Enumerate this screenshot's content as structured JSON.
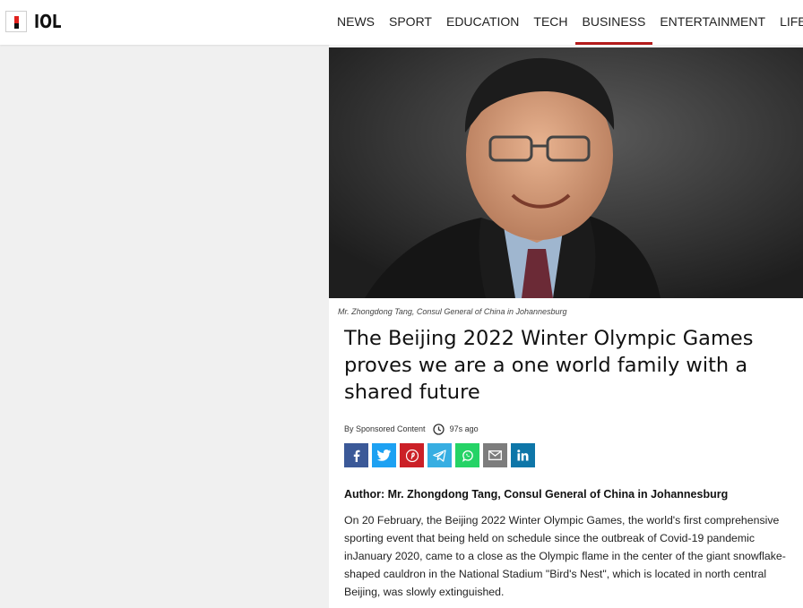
{
  "brand": {
    "name": "IOL"
  },
  "nav": [
    {
      "label": "NEWS",
      "active": false
    },
    {
      "label": "SPORT",
      "active": false
    },
    {
      "label": "EDUCATION",
      "active": false
    },
    {
      "label": "TECH",
      "active": false
    },
    {
      "label": "BUSINESS",
      "active": true
    },
    {
      "label": "ENTERTAINMENT",
      "active": false
    },
    {
      "label": "LIFESTYLE",
      "active": false
    }
  ],
  "article": {
    "caption": "Mr. Zhongdong Tang, Consul General of China in Johannesburg",
    "headline": "The Beijing 2022 Winter Olympic Games proves we are a one world family with a shared future",
    "byline": "By Sponsored Content",
    "time": "97s ago",
    "share": [
      {
        "icon": "facebook-icon",
        "color": "#3b5998"
      },
      {
        "icon": "twitter-icon",
        "color": "#1da1f2"
      },
      {
        "icon": "pinterest-icon",
        "color": "#cb2027"
      },
      {
        "icon": "telegram-icon",
        "color": "#37aee2"
      },
      {
        "icon": "whatsapp-icon",
        "color": "#25d366"
      },
      {
        "icon": "email-icon",
        "color": "#7d7d7d"
      },
      {
        "icon": "linkedin-icon",
        "color": "#0e76a8"
      }
    ],
    "author": "Author: Mr. Zhongdong Tang, Consul General of China in Johannesburg",
    "paragraph": "On 20 February, the Beijing 2022 Winter Olympic Games, the world's first comprehensive sporting event that being held on schedule since the outbreak of Covid-19 pandemic inJanuary 2020, came to a close as the Olympic flame in the center of the giant snowflake-shaped cauldron in the National Stadium \"Bird's Nest\", which is located in north central Beijing, was slowly extinguished."
  },
  "colors": {
    "accent": "#b31b1b",
    "brand_red": "#e0211d"
  }
}
